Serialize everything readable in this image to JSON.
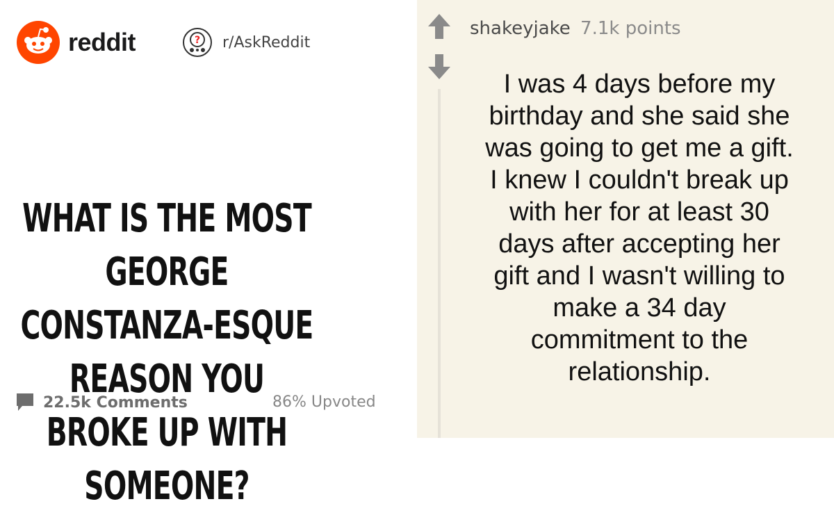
{
  "header": {
    "brand_name": "reddit",
    "subreddit": "r/AskReddit"
  },
  "post": {
    "title": "WHAT IS THE MOST GEORGE CONSTANZA-ESQUE REASON YOU BROKE UP WITH SOMEONE?",
    "comments_label": "22.5k Comments",
    "upvoted_label": "86% Upvoted"
  },
  "comment": {
    "username": "shakeyjake",
    "points": "7.1k points",
    "text": "I was 4 days before my birthday and she said she was going to get me a gift. I knew I couldn't break up with her for at least 30 days after accepting her gift and I wasn't willing to make a 34 day commitment to the relationship."
  },
  "colors": {
    "brand_orange": "#ff4500",
    "comment_bg": "#f7f3e7",
    "vote_arrow": "#8a8a8a"
  }
}
